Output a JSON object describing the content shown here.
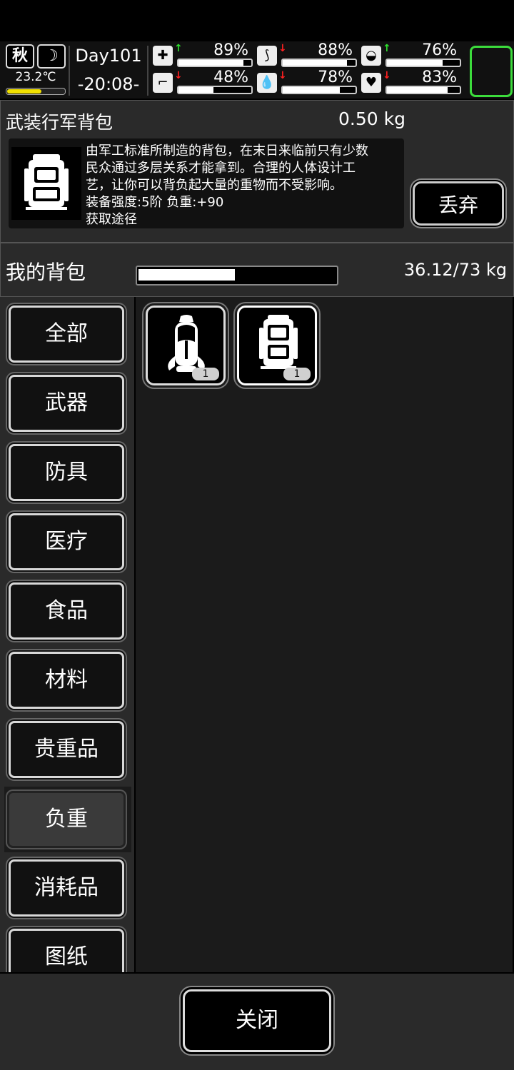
{
  "status": {
    "season": "秋",
    "temperature": "23.2℃",
    "temperature_level": 0.6,
    "day": "Day101",
    "time": "-20:08-",
    "stats": [
      {
        "icon": "medkit-icon",
        "trend": "up",
        "pct": "89%",
        "level": 0.89
      },
      {
        "icon": "stomach-icon",
        "trend": "down",
        "pct": "88%",
        "level": 0.88
      },
      {
        "icon": "brain-icon",
        "trend": "up",
        "pct": "76%",
        "level": 0.76
      },
      {
        "icon": "boot-icon",
        "trend": "down",
        "pct": "48%",
        "level": 0.48
      },
      {
        "icon": "water-drop-icon",
        "trend": "down",
        "pct": "78%",
        "level": 0.78
      },
      {
        "icon": "heart-icon",
        "trend": "down",
        "pct": "83%",
        "level": 0.83
      }
    ]
  },
  "item": {
    "name": "武装行军背包",
    "weight": "0.50 kg",
    "description": "由军工标准所制造的背包，在末日来临前只有少数\n民众通过多层关系才能拿到。合理的人体设计工\n艺，让你可以背负起大量的重物而不受影响。\n装备强度:5阶  负重:+90\n获取途径",
    "discard_label": "丢弃"
  },
  "bag": {
    "title": "我的背包",
    "weight": "36.12/73 kg",
    "fill": 0.49
  },
  "categories": [
    "全部",
    "武器",
    "防具",
    "医疗",
    "食品",
    "材料",
    "贵重品",
    "负重",
    "消耗品",
    "图纸"
  ],
  "active_category": "负重",
  "items": [
    {
      "icon": "hiking-backpack-icon",
      "count": "1"
    },
    {
      "icon": "military-backpack-icon",
      "count": "1"
    }
  ],
  "close_label": "关闭"
}
